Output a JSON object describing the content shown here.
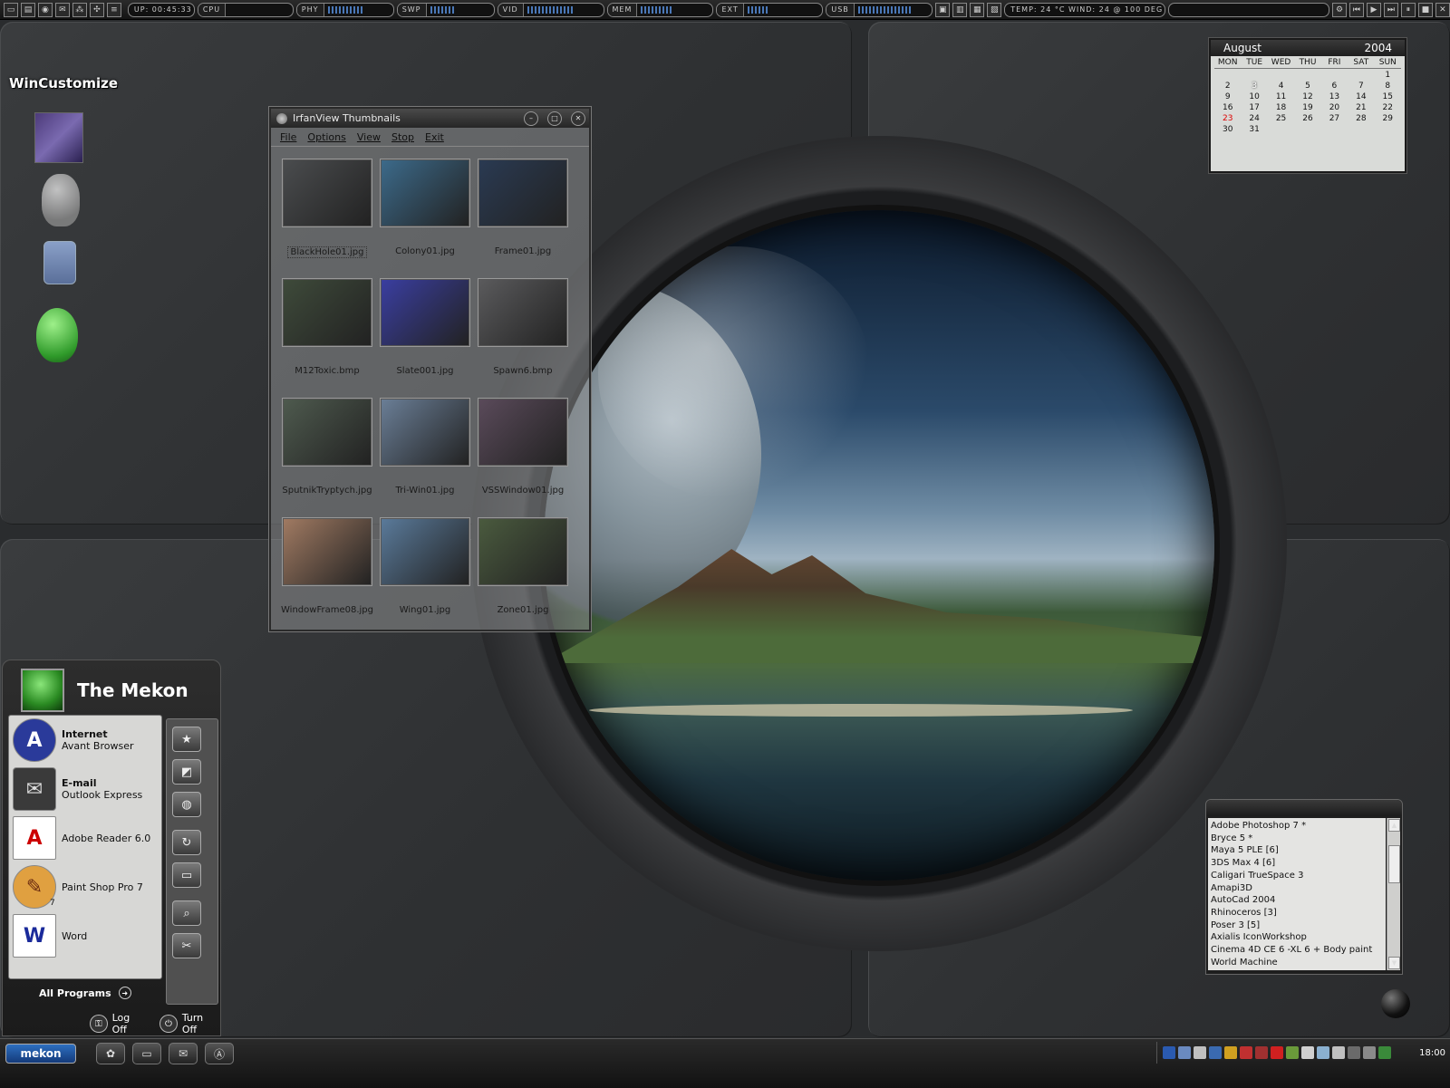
{
  "topbar": {
    "uptime": "UP: 00:45:33",
    "cpu_label": "CPU",
    "phy_label": "PHY",
    "swp_label": "SWP",
    "vid_label": "VID",
    "mem_label": "MEM",
    "ext_label": "EXT",
    "usb_label": "USB",
    "weather": "TEMP: 24 °C  WIND: 24  @ 100  DEG"
  },
  "desktop": {
    "wincustomize_logo": "WinCustomize"
  },
  "calendar": {
    "month": "August",
    "year": "2004",
    "days_of_week": [
      "MON",
      "TUE",
      "WED",
      "THU",
      "FRI",
      "SAT",
      "SUN"
    ],
    "weeks": [
      [
        "",
        "",
        "",
        "",
        "",
        "",
        "1"
      ],
      [
        "2",
        "3",
        "4",
        "5",
        "6",
        "7",
        "8"
      ],
      [
        "9",
        "10",
        "11",
        "12",
        "13",
        "14",
        "15"
      ],
      [
        "16",
        "17",
        "18",
        "19",
        "20",
        "21",
        "22"
      ],
      [
        "23",
        "24",
        "25",
        "26",
        "27",
        "28",
        "29"
      ],
      [
        "30",
        "31",
        "",
        "",
        "",
        "",
        ""
      ]
    ],
    "today": "23",
    "marked": "3"
  },
  "irfanview": {
    "title": "IrfanView Thumbnails",
    "menu": [
      "File",
      "Options",
      "View",
      "Stop",
      "Exit"
    ],
    "thumbnails": [
      {
        "name": "BlackHole01.jpg",
        "color": "#4a4c4e"
      },
      {
        "name": "Colony01.jpg",
        "color": "#3c6a8a"
      },
      {
        "name": "Frame01.jpg",
        "color": "#2a3a52"
      },
      {
        "name": "M12Toxic.bmp",
        "color": "#3e4a3a"
      },
      {
        "name": "Slate001.jpg",
        "color": "#3a3ea0"
      },
      {
        "name": "Spawn6.bmp",
        "color": "#5a5a5c"
      },
      {
        "name": "SputnikTryptych.jpg",
        "color": "#4e5a4e"
      },
      {
        "name": "Tri-Win01.jpg",
        "color": "#6a7e96"
      },
      {
        "name": "VSSWindow01.jpg",
        "color": "#5a4a5a"
      },
      {
        "name": "WindowFrame08.jpg",
        "color": "#a07a62"
      },
      {
        "name": "Wing01.jpg",
        "color": "#5a7a9a"
      },
      {
        "name": "Zone01.jpg",
        "color": "#4a5a3e"
      }
    ]
  },
  "start_menu": {
    "user_name": "The Mekon",
    "pinned": [
      {
        "title": "Internet",
        "subtitle": "Avant Browser",
        "icon": "avant-browser-icon"
      },
      {
        "title": "E-mail",
        "subtitle": "Outlook Express",
        "icon": "outlook-express-icon"
      }
    ],
    "recent": [
      {
        "label": "Adobe Reader 6.0",
        "icon": "adobe-reader-icon"
      },
      {
        "label": "Paint Shop Pro 7",
        "badge": "7",
        "icon": "paint-shop-pro-icon"
      },
      {
        "label": "Word",
        "icon": "word-icon"
      }
    ],
    "all_programs": "All Programs",
    "log_off": "Log Off",
    "turn_off": "Turn Off"
  },
  "launcher": {
    "items": [
      "Adobe Photoshop 7 *",
      "Bryce 5 *",
      "Maya 5 PLE [6]",
      "3DS Max 4 [6]",
      "Caligari TrueSpace 3",
      "Amapi3D",
      "AutoCad 2004",
      "Rhinoceros [3]",
      "Poser 3 [5]",
      "Axialis IconWorkshop",
      "Cinema 4D CE 6 -XL 6 + Body paint",
      "World Machine"
    ]
  },
  "taskbar": {
    "start_label": "mekon",
    "clock": "18:00",
    "tray_colors": [
      "#2a5ab0",
      "#6a8ac0",
      "#c0c0c0",
      "#3a6ab0",
      "#d0a020",
      "#c03030",
      "#a03030",
      "#d02020",
      "#6a9a3a",
      "#d0d0d0",
      "#8ab0d0",
      "#c0c0c0",
      "#6a6a6a",
      "#8a8a8a",
      "#3a8a3a"
    ]
  }
}
